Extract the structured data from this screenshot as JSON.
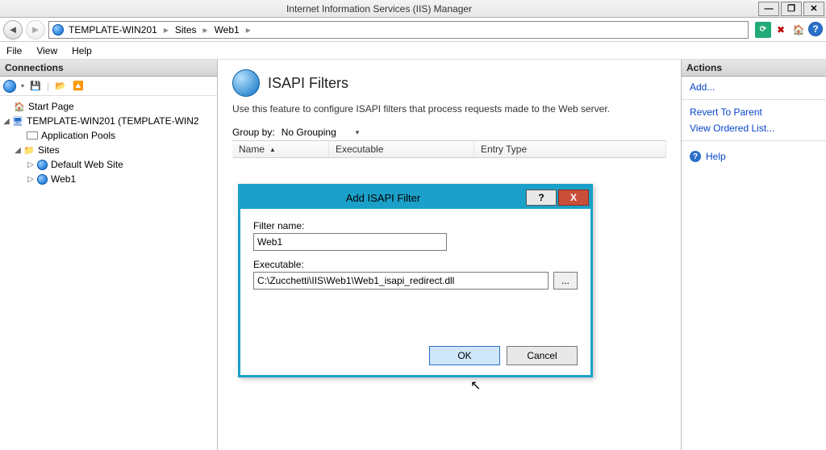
{
  "window": {
    "title": "Internet Information Services (IIS) Manager"
  },
  "breadcrumb": {
    "seg1": "TEMPLATE-WIN201",
    "seg2": "Sites",
    "seg3": "Web1"
  },
  "menu": {
    "file": "File",
    "view": "View",
    "help": "Help"
  },
  "connections": {
    "header": "Connections",
    "start_page": "Start Page",
    "server": "TEMPLATE-WIN201 (TEMPLATE-WIN2",
    "app_pools": "Application Pools",
    "sites": "Sites",
    "default_site": "Default Web Site",
    "web1": "Web1"
  },
  "content": {
    "title": "ISAPI Filters",
    "desc": "Use this feature to configure ISAPI filters that process requests made to the Web server.",
    "group_by_label": "Group by:",
    "group_by_value": "No Grouping",
    "col_name": "Name",
    "col_exec": "Executable",
    "col_entry": "Entry Type"
  },
  "actions": {
    "header": "Actions",
    "add": "Add...",
    "revert": "Revert To Parent",
    "ordered": "View Ordered List...",
    "help": "Help"
  },
  "dialog": {
    "title": "Add ISAPI Filter",
    "filter_name_label": "Filter name:",
    "filter_name_value": "Web1",
    "exec_label": "Executable:",
    "exec_value": "C:\\Zucchetti\\IIS\\Web1\\Web1_isapi_redirect.dll",
    "browse": "...",
    "ok": "OK",
    "cancel": "Cancel",
    "help": "?",
    "close": "X"
  }
}
